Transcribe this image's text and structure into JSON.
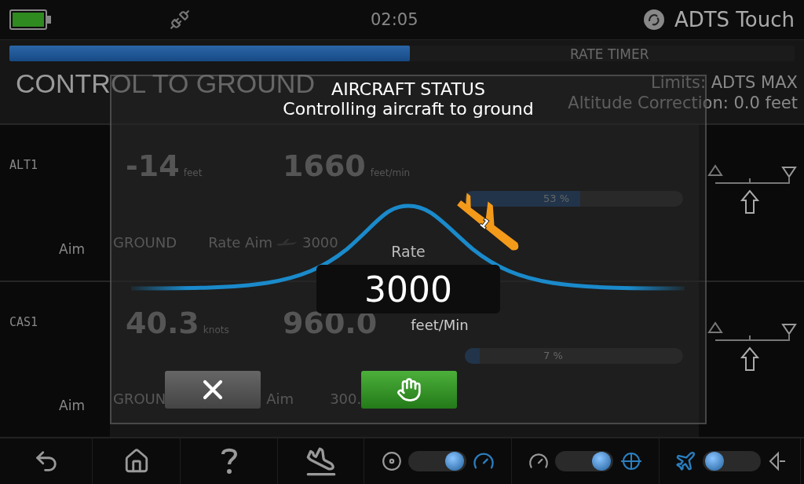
{
  "status_bar": {
    "time": "02:05",
    "app_name": "ADTS Touch"
  },
  "rate_timer": {
    "label": "RATE TIMER",
    "level": 0.51
  },
  "title": "CONTROL TO GROUND",
  "limits": "Limits: ADTS MAX",
  "altitude_correction": "Altitude Correction: 0.0 feet",
  "channels": [
    {
      "name": "ALT1",
      "value": "-14",
      "unit": "feet",
      "rate": "1660",
      "rate_unit": "feet/min",
      "level": 0.53,
      "reading": "53 %",
      "aim_label": "Aim",
      "aim": "GROUND",
      "rate_aim_label": "Rate Aim",
      "rate_aim": "3000"
    },
    {
      "name": "CAS1",
      "value": "40.3",
      "unit": "knots",
      "rate": "960.0",
      "level": 0.07,
      "reading": "7 %",
      "aim_label": "Aim",
      "aim": "GROUN",
      "rate_aim_label": "Aim",
      "rate_aim": "300."
    }
  ],
  "dialog": {
    "title": "AIRCRAFT STATUS",
    "message": "Controlling aircraft to ground",
    "marker": "1",
    "rate_label": "Rate",
    "rate_value": "3000",
    "rate_unit": "feet/Min"
  },
  "nav": {
    "toggles": [
      {
        "on": true
      },
      {
        "on": true
      },
      {
        "on": false
      }
    ]
  }
}
